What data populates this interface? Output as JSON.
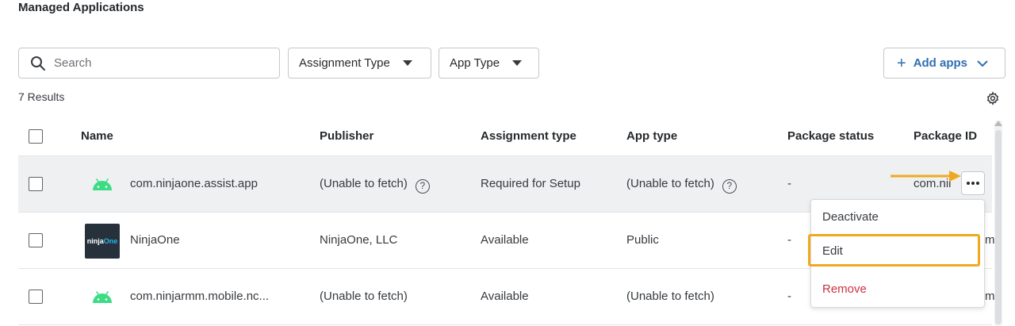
{
  "page": {
    "title": "Managed Applications"
  },
  "toolbar": {
    "search_placeholder": "Search",
    "assignment_type_label": "Assignment Type",
    "app_type_label": "App Type",
    "add_apps_label": "Add apps"
  },
  "results": {
    "label": "7 Results"
  },
  "table": {
    "columns": [
      "Name",
      "Publisher",
      "Assignment type",
      "App type",
      "Package status",
      "Package ID"
    ],
    "rows": [
      {
        "name": "com.ninjaone.assist.app",
        "publisher": "(Unable to fetch)",
        "assignment_type": "Required for Setup",
        "app_type": "(Unable to fetch)",
        "package_status": "-",
        "package_id": "com.nii",
        "icon": "android-icon"
      },
      {
        "name": "NinjaOne",
        "publisher": "NinjaOne, LLC",
        "assignment_type": "Available",
        "app_type": "Public",
        "package_status": "-",
        "package_id": "m",
        "icon": "ninjaone-logo",
        "logo_text_a": "ninja",
        "logo_text_b": "One"
      },
      {
        "name": "com.ninjarmm.mobile.nc...",
        "publisher": "(Unable to fetch)",
        "assignment_type": "Available",
        "app_type": "(Unable to fetch)",
        "package_status": "-",
        "package_id": "m",
        "icon": "android-icon"
      }
    ]
  },
  "context_menu": {
    "items": [
      "Deactivate",
      "Edit",
      "Remove"
    ]
  },
  "colors": {
    "accent": "#2f6fb3",
    "highlight": "#f0a91f",
    "danger": "#c8323f",
    "android_green": "#3ddc84"
  }
}
